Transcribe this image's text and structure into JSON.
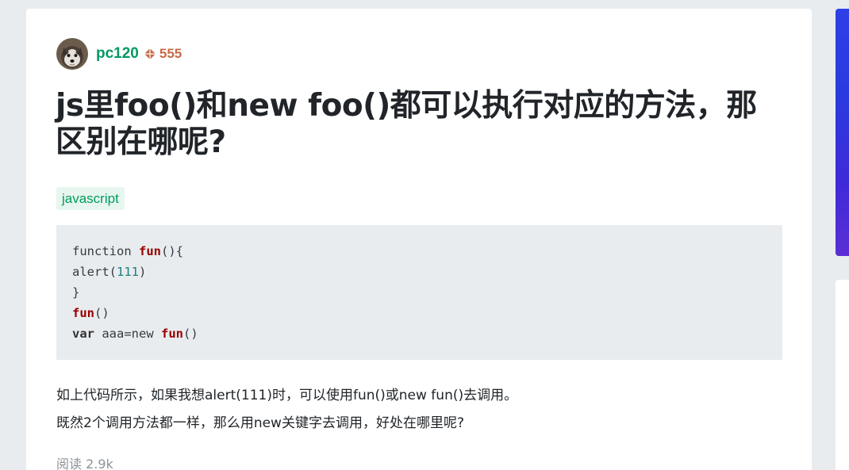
{
  "author": {
    "name": "pc120",
    "reputation": "555",
    "avatar_icon": "husky-avatar",
    "rep_icon": "reputation-icon"
  },
  "question": {
    "title": "js里foo()和new foo()都可以执行对应的方法，那区别在哪呢?",
    "tag": "javascript"
  },
  "code": {
    "lines": [
      [
        {
          "t": "function ",
          "c": "plain"
        },
        {
          "t": "fun",
          "c": "fn"
        },
        {
          "t": "(){",
          "c": "plain"
        }
      ],
      [
        {
          "t": "alert(",
          "c": "plain"
        },
        {
          "t": "111",
          "c": "num"
        },
        {
          "t": ")",
          "c": "plain"
        }
      ],
      [
        {
          "t": "}",
          "c": "plain"
        }
      ],
      [
        {
          "t": "fun",
          "c": "fn"
        },
        {
          "t": "()",
          "c": "plain"
        }
      ],
      [
        {
          "t": "var",
          "c": "kw"
        },
        {
          "t": " aaa=new ",
          "c": "plain"
        },
        {
          "t": "fun",
          "c": "fn"
        },
        {
          "t": "()",
          "c": "plain"
        }
      ]
    ]
  },
  "body": {
    "paragraph1": "如上代码所示，如果我想alert(111)时，可以使用fun()或new fun()去调用。",
    "paragraph2": "既然2个调用方法都一样，那么用new关键字去调用，好处在哪里呢?"
  },
  "meta": {
    "reads": "阅读 2.9k"
  },
  "colors": {
    "accent_green": "#019a61",
    "reputation": "#c66a48",
    "banner": "#2e3fe6"
  }
}
